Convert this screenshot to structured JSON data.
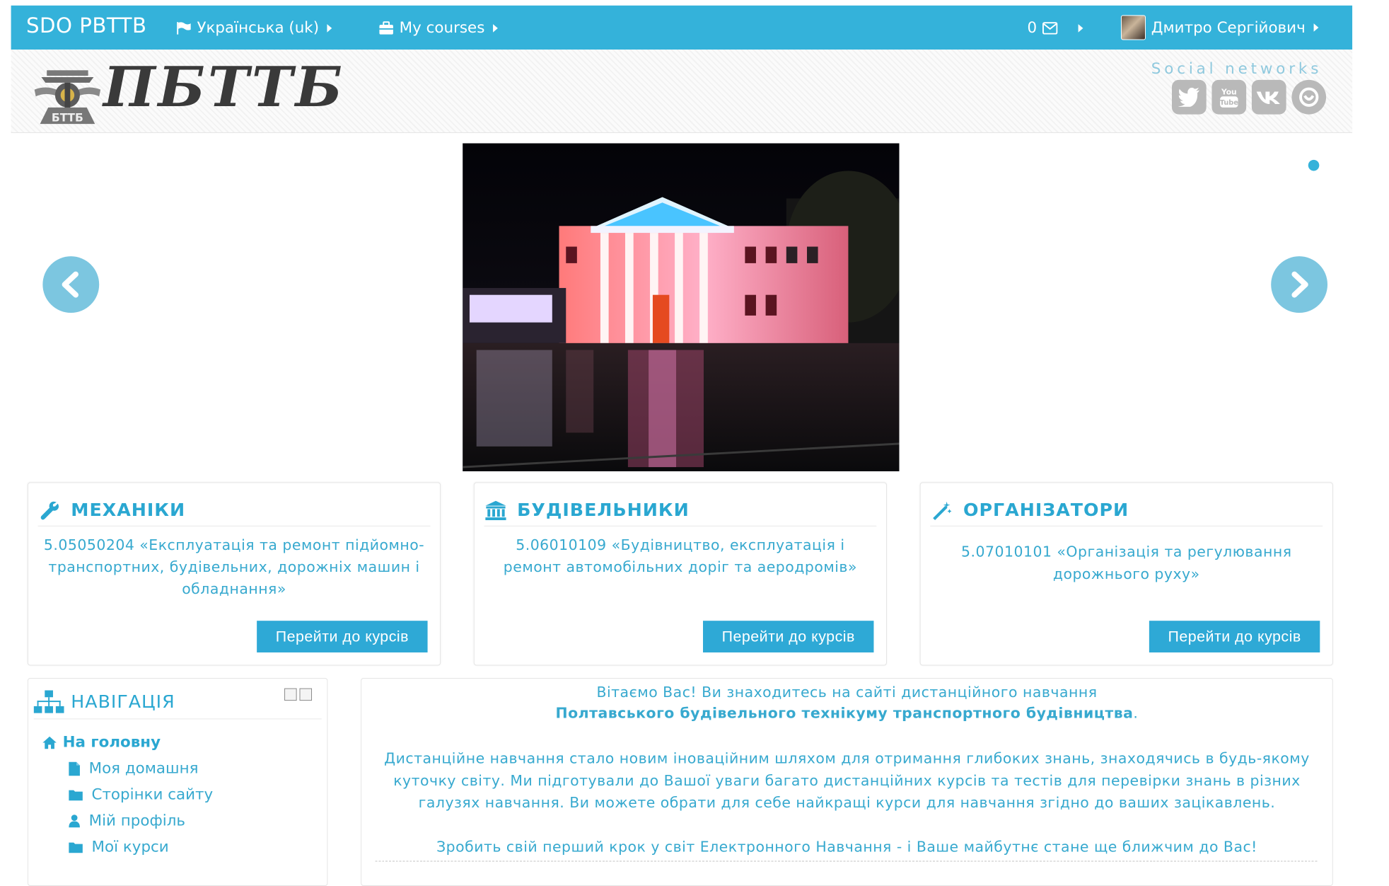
{
  "navbar": {
    "brand": "SDO PBTTB",
    "language": "Українська (uk)",
    "my_courses": "My courses",
    "messages_count": "0",
    "user_name": "Дмитро Сергійович"
  },
  "header": {
    "logo_text": "ПБТТБ",
    "emblem_label": "БТТБ",
    "social_label": "Social networks",
    "social_icons": [
      "twitter-icon",
      "youtube-icon",
      "vk-icon",
      "other-social-icon"
    ]
  },
  "cards": [
    {
      "title": "МЕХАНІКИ",
      "text": "5.05050204 «Експлуатація та ремонт підйомно-транспортних, будівельних, дорожніх машин і обладнання»",
      "button": "Перейти до курсів",
      "icon": "wrench-icon"
    },
    {
      "title": "БУДІВЕЛЬНИКИ",
      "text": "5.06010109 «Будівництво, експлуатація і ремонт автомобільних доріг та аеродромів»",
      "button": "Перейти до курсів",
      "icon": "bank-icon"
    },
    {
      "title": "ОРГАНІЗАТОРИ",
      "text": "5.07010101 «Організація та регулювання дорожнього руху»",
      "button": "Перейти до курсів",
      "icon": "magic-wand-icon"
    }
  ],
  "navigation": {
    "title": "НАВІГАЦІЯ",
    "home": "На головну",
    "items": [
      "Моя домашня",
      "Сторінки сайту",
      "Мій профіль",
      "Мої курси"
    ]
  },
  "welcome": {
    "line1": "Вітаємо Вас! Ви знаходитесь на сайті дистанційного навчання",
    "line2": "Полтавського будівельного технікуму транспортного будівництва",
    "line2_suffix": ".",
    "para": "Дистанційне навчання стало новим іноваційним шляхом для отримання глибоких знань, знаходячись в будь-якому куточку світу. Ми підготували до Вашої уваги багато дистанційних курсів та тестів для перевірки знань в різних галузях навчання. Ви можете обрати для себе найкращі курси для навчання згідно до ваших зацікавлень.",
    "line3": "Зробить свій перший крок у світ Електронного Навчання - і Ваше майбутнє стане ще ближчим до Вас!"
  },
  "colors": {
    "accent": "#34b2da",
    "text": "#2aa7d1"
  }
}
